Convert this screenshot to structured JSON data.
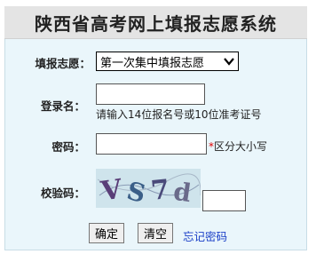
{
  "header": {
    "title": "陕西省高考网上填报志愿系统"
  },
  "form": {
    "volunteer_label": "填报志愿：",
    "volunteer_selected": "第一次集中填报志愿",
    "login_label": "登录名：",
    "login_value": "",
    "login_hint": "请输入14位报名号或10位准考证号",
    "password_label": "密码：",
    "password_value": "",
    "password_required_mark": "*",
    "password_hint": "区分大小写",
    "captcha_label": "校验码：",
    "captcha_text": "VS7d",
    "captcha_value": ""
  },
  "actions": {
    "confirm_label": "确定",
    "clear_label": "清空",
    "forgot_label": "忘记密码"
  },
  "colors": {
    "panel_bg": "#eaf6fb",
    "title_bg": "#e4e4e4",
    "link": "#1a3fc7",
    "required": "#e00000"
  }
}
